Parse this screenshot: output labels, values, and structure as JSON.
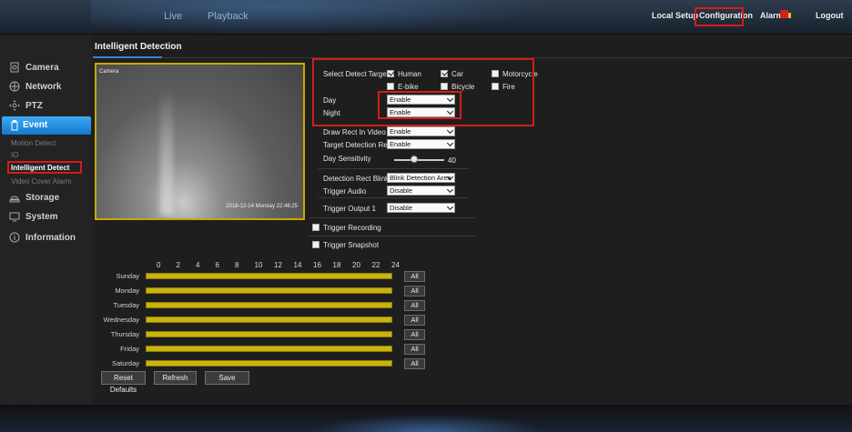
{
  "topnav": {
    "live": "Live",
    "playback": "Playback",
    "local_setup": "Local Setup",
    "configuration": "Configuration",
    "alarm": "Alarm",
    "logout": "Logout"
  },
  "sidebar": {
    "camera": "Camera",
    "network": "Network",
    "ptz": "PTZ",
    "event": "Event",
    "sub": {
      "motion_detect": "Motion Detect",
      "io": "IO",
      "intelligent_detect": "Intelligent Detect",
      "video_cover_alarm": "Video Cover Alarm"
    },
    "storage": "Storage",
    "system": "System",
    "information": "Information"
  },
  "page": {
    "title": "Intelligent Detection"
  },
  "video": {
    "camera_label": "Camera",
    "timestamp": "2018-12-14 Monday 22:46:25"
  },
  "settings": {
    "select_detect_target": "Select Detect Target",
    "targets": {
      "human": {
        "label": "Human",
        "checked": true
      },
      "car": {
        "label": "Car",
        "checked": true
      },
      "motorcycle": {
        "label": "Motorcycle",
        "checked": false
      },
      "ebike": {
        "label": "E-bike",
        "checked": false
      },
      "bicycle": {
        "label": "Bicycle",
        "checked": false
      },
      "fire": {
        "label": "Fire",
        "checked": false
      }
    },
    "day_label": "Day",
    "day_value": "Enable",
    "night_label": "Night",
    "night_value": "Enable",
    "draw_rect_label": "Draw Rect In Video",
    "draw_rect_value": "Enable",
    "target_rect_label": "Target Detection Rect",
    "target_rect_value": "Enable",
    "day_sensitivity_label": "Day Sensitivity",
    "day_sensitivity_value": "40",
    "detection_blink_label": "Detection Rect Blink",
    "detection_blink_value": "Blink Detection Area",
    "trigger_audio_label": "Trigger Audio",
    "trigger_audio_value": "Disable",
    "trigger_output_label": "Trigger Output 1",
    "trigger_output_value": "Disable",
    "trigger_recording": "Trigger Recording",
    "trigger_snapshot": "Trigger Snapshot"
  },
  "schedule": {
    "hours": [
      "0",
      "2",
      "4",
      "6",
      "8",
      "10",
      "12",
      "14",
      "16",
      "18",
      "20",
      "22",
      "24"
    ],
    "days": [
      "Sunday",
      "Monday",
      "Tuesday",
      "Wednesday",
      "Thursday",
      "Friday",
      "Saturday"
    ],
    "all_label": "All"
  },
  "buttons": {
    "reset": "Reset Defaults",
    "refresh": "Refresh",
    "save": "Save"
  },
  "colors": {
    "accent": "#1a8ae0",
    "highlight": "#d61b1b",
    "schedule_fill": "#c9b40f"
  }
}
